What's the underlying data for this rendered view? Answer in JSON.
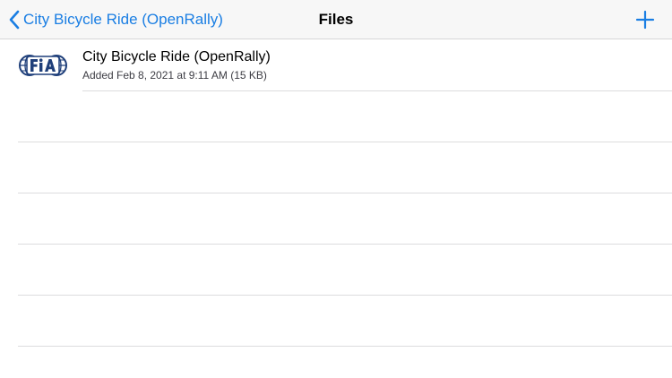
{
  "nav": {
    "back_label": "City Bicycle Ride (OpenRally)",
    "title": "Files",
    "add_icon": "plus-icon",
    "back_icon": "chevron-left-icon"
  },
  "files": [
    {
      "name": "City Bicycle Ride (OpenRally)",
      "meta": "Added Feb 8, 2021 at 9:11 AM (15 KB)",
      "icon": "fia-logo-icon"
    }
  ],
  "colors": {
    "accent": "#1a7ee3",
    "logo_blue": "#1f3f7a",
    "nav_background": "#f7f7f7",
    "separator": "#dcdcde"
  }
}
